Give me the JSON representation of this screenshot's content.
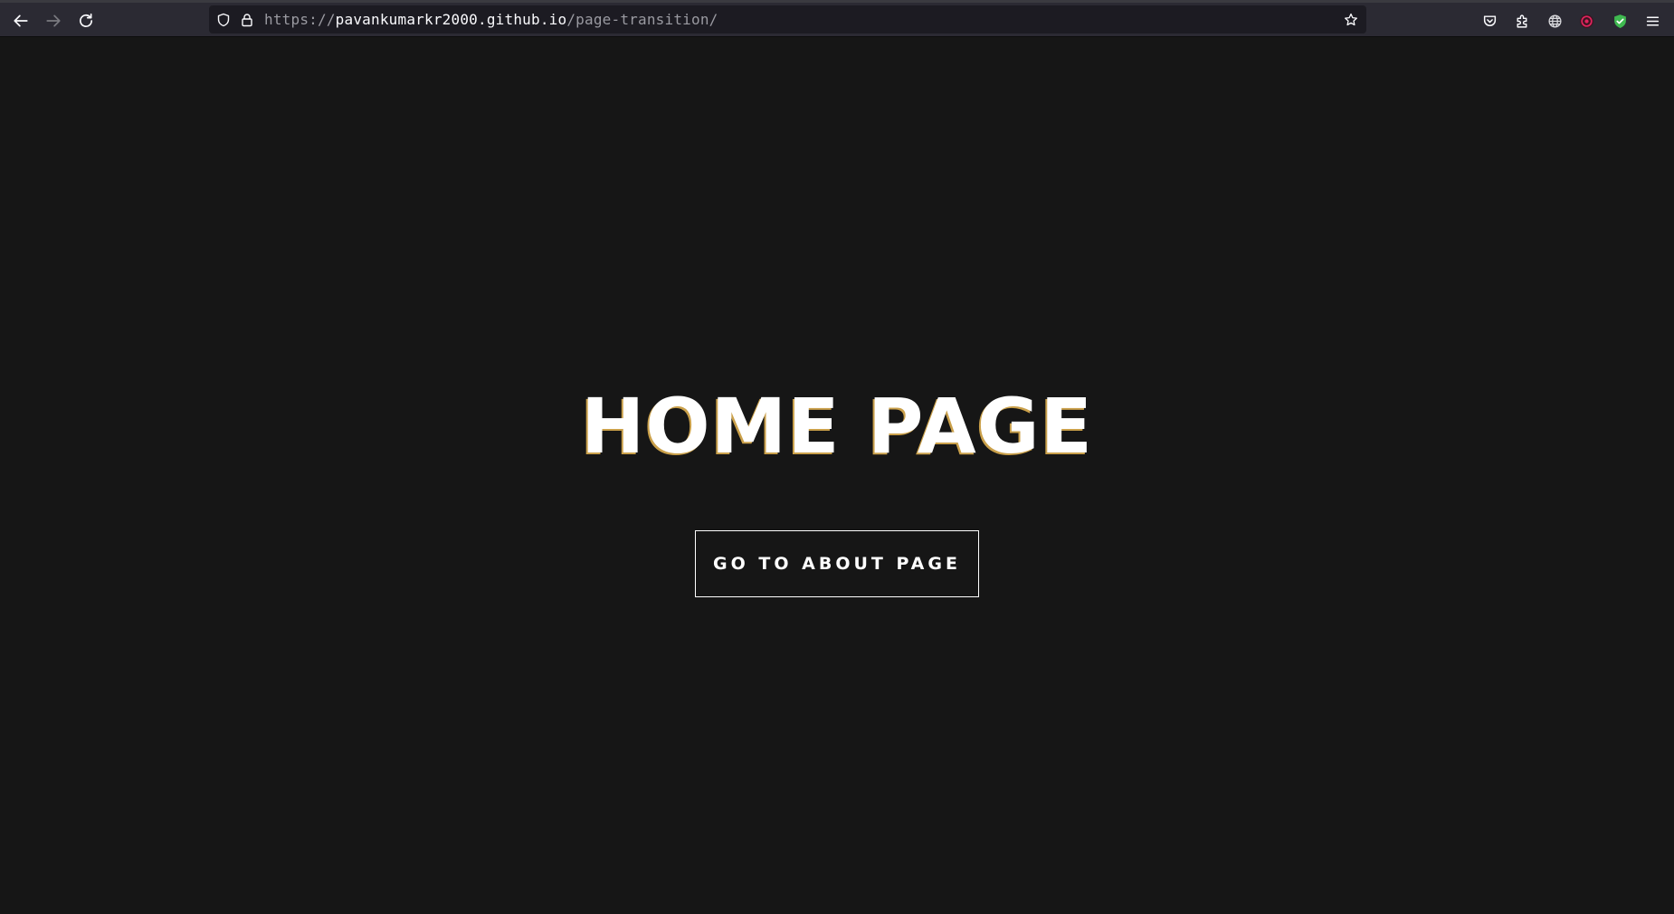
{
  "browser": {
    "url": {
      "scheme": "https://",
      "host": "pavankumarkr2000.github.io",
      "path": "/page-transition/"
    },
    "icons": {
      "back": "back-arrow-icon",
      "forward": "forward-arrow-icon",
      "reload": "reload-icon",
      "tracking_protection": "shield-icon",
      "security": "lock-icon",
      "bookmark": "star-icon",
      "pocket": "pocket-icon",
      "extensions": "puzzle-icon",
      "translate": "globe-icon",
      "ext_red": "red-extension-icon",
      "ext_green": "green-shield-extension-icon",
      "menu": "hamburger-menu-icon"
    },
    "colors": {
      "toolbar": "#2b2a33",
      "urlbar": "#1c1b22",
      "ext_red": "#e0245e",
      "ext_green": "#3fb950"
    }
  },
  "page": {
    "background": "#161616",
    "title": "HOME PAGE",
    "button_label": "GO TO ABOUT PAGE"
  }
}
